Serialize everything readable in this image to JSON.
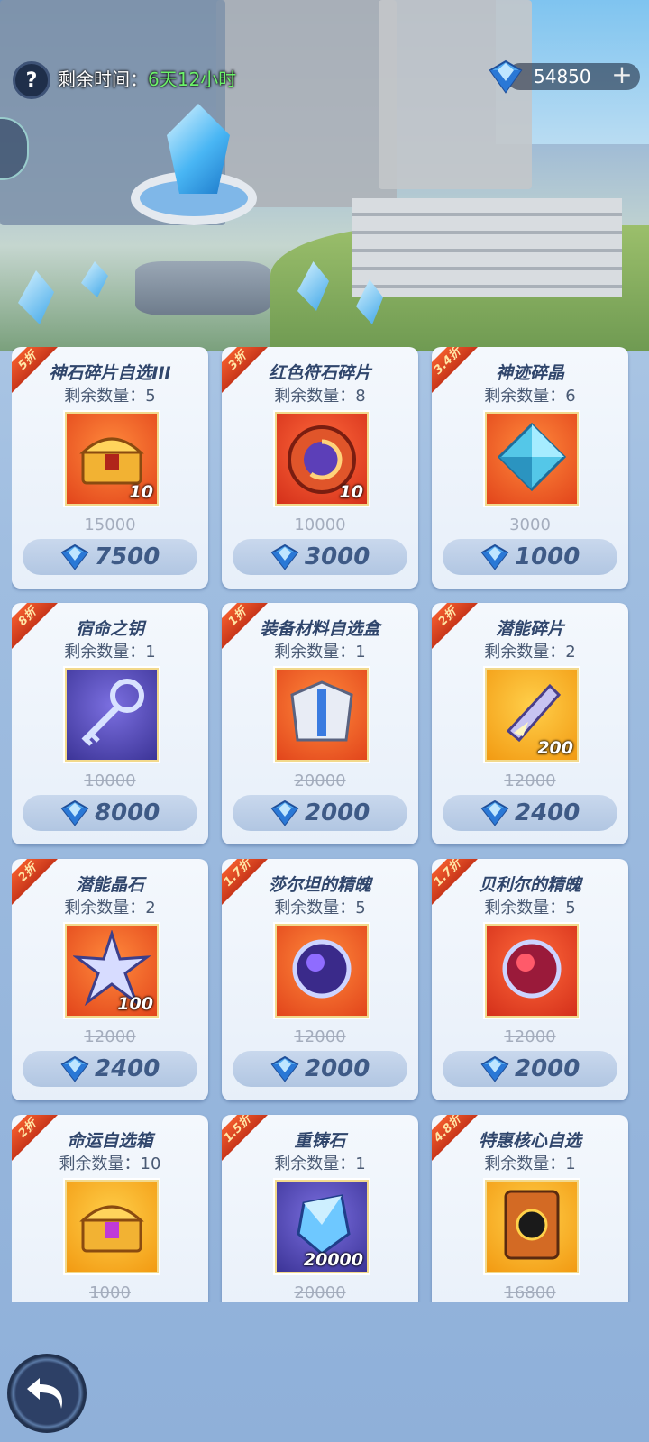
{
  "header": {
    "help_label": "?",
    "timer_label": "剩余时间：",
    "timer_value": "6天12小时",
    "currency_amount": "54850",
    "currency_plus": "+"
  },
  "colors": {
    "ribbon": "#e04a22",
    "timer_value": "#6cf26a",
    "price_text": "#3e5a86",
    "card_bg": "#eef4fb"
  },
  "items": [
    {
      "discount": "5折",
      "name": "神石碎片自选III",
      "qty": "剩余数量：5",
      "icon": "gold-treasure-chest-icon",
      "bg": "orange",
      "count": "10",
      "old_price": "15000",
      "price": "7500"
    },
    {
      "discount": "3折",
      "name": "红色符石碎片",
      "qty": "剩余数量：8",
      "icon": "red-rune-stone-icon",
      "bg": "red",
      "count": "10",
      "old_price": "10000",
      "price": "3000"
    },
    {
      "discount": "3.4折",
      "name": "神迹碎晶",
      "qty": "剩余数量：6",
      "icon": "blue-crystal-icon",
      "bg": "orange",
      "count": "",
      "old_price": "3000",
      "price": "1000"
    },
    {
      "discount": "8折",
      "name": "宿命之钥",
      "qty": "剩余数量：1",
      "icon": "silver-key-icon",
      "bg": "purple",
      "count": "",
      "old_price": "10000",
      "price": "8000"
    },
    {
      "discount": "1折",
      "name": "装备材料自选盒",
      "qty": "剩余数量：1",
      "icon": "armor-box-icon",
      "bg": "orange",
      "count": "",
      "old_price": "20000",
      "price": "2000"
    },
    {
      "discount": "2折",
      "name": "潜能碎片",
      "qty": "剩余数量：2",
      "icon": "potential-shard-icon",
      "bg": "gold",
      "count": "200",
      "old_price": "12000",
      "price": "2400"
    },
    {
      "discount": "2折",
      "name": "潜能晶石",
      "qty": "剩余数量：2",
      "icon": "star-crystal-icon",
      "bg": "orange",
      "count": "100",
      "old_price": "12000",
      "price": "2400"
    },
    {
      "discount": "1.7折",
      "name": "莎尔坦的精魄",
      "qty": "剩余数量：5",
      "icon": "purple-spirit-orb-icon",
      "bg": "orange",
      "count": "",
      "old_price": "12000",
      "price": "2000"
    },
    {
      "discount": "1.7折",
      "name": "贝利尔的精魄",
      "qty": "剩余数量：5",
      "icon": "red-spirit-orb-icon",
      "bg": "red",
      "count": "",
      "old_price": "12000",
      "price": "2000"
    },
    {
      "discount": "2折",
      "name": "命运自选箱",
      "qty": "剩余数量：10",
      "icon": "fate-chest-icon",
      "bg": "gold",
      "count": "",
      "old_price": "1000",
      "price": ""
    },
    {
      "discount": "1.5折",
      "name": "重铸石",
      "qty": "剩余数量：1",
      "icon": "reforge-stone-icon",
      "bg": "purple",
      "count": "20000",
      "old_price": "20000",
      "price": ""
    },
    {
      "discount": "4.8折",
      "name": "特惠核心自选",
      "qty": "剩余数量：1",
      "icon": "core-card-icon",
      "bg": "gold",
      "count": "",
      "old_price": "16800",
      "price": ""
    }
  ],
  "back_button": "back-arrow-icon"
}
